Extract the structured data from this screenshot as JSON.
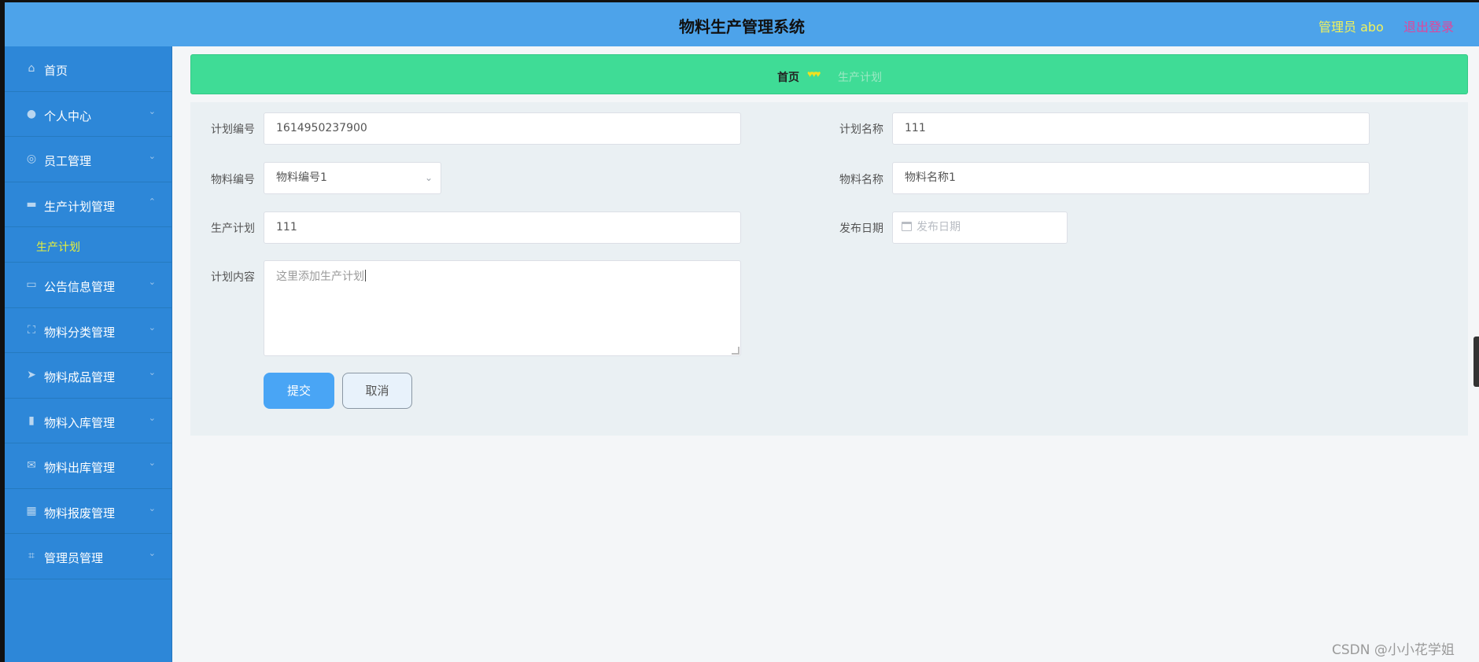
{
  "header": {
    "title": "物料生产管理系统",
    "user_label": "管理员 abo",
    "logout_label": "退出登录"
  },
  "sidebar": {
    "items": [
      {
        "label": "首页",
        "icon": "home-icon",
        "glyph": "⌂",
        "chevron": ""
      },
      {
        "label": "个人中心",
        "icon": "user-icon",
        "glyph": "●",
        "chevron": "⌄"
      },
      {
        "label": "员工管理",
        "icon": "support-icon",
        "glyph": "◎",
        "chevron": "⌄"
      },
      {
        "label": "生产计划管理",
        "icon": "monitor-icon",
        "glyph": "▬",
        "chevron": "⌃"
      },
      {
        "label": "公告信息管理",
        "icon": "notice-icon",
        "glyph": "▭",
        "chevron": "⌄"
      },
      {
        "label": "物料分类管理",
        "icon": "full-screen-icon",
        "glyph": "⛶",
        "chevron": "⌄"
      },
      {
        "label": "物料成品管理",
        "icon": "send-icon",
        "glyph": "➤",
        "chevron": "⌄"
      },
      {
        "label": "物料入库管理",
        "icon": "bar-chart-icon",
        "glyph": "▮",
        "chevron": "⌄"
      },
      {
        "label": "物料出库管理",
        "icon": "message-icon",
        "glyph": "✉",
        "chevron": "⌄"
      },
      {
        "label": "物料报废管理",
        "icon": "menu-grid-icon",
        "glyph": "▦",
        "chevron": "⌄"
      },
      {
        "label": "管理员管理",
        "icon": "crop-icon",
        "glyph": "⌗",
        "chevron": "⌄"
      }
    ],
    "submenu_active": "生产计划"
  },
  "breadcrumb": {
    "home": "首页",
    "separator": "♥♥♥",
    "current": "生产计划"
  },
  "form": {
    "plan_no_label": "计划编号",
    "plan_no_value": "1614950237900",
    "plan_name_label": "计划名称",
    "plan_name_value": "111",
    "material_no_label": "物料编号",
    "material_no_value": "物料编号1",
    "material_name_label": "物料名称",
    "material_name_value": "物料名称1",
    "production_plan_label": "生产计划",
    "production_plan_value": "111",
    "publish_date_label": "发布日期",
    "publish_date_placeholder": "发布日期",
    "content_label": "计划内容",
    "content_placeholder": "这里添加生产计划",
    "submit_label": "提交",
    "cancel_label": "取消"
  },
  "watermark": "CSDN @小小花学姐",
  "colors": {
    "header": "#4da3ea",
    "sidebar": "#2d87d8",
    "breadcrumb_bg": "#3fdc96",
    "submit": "#49a5f5",
    "user_text": "#f2f25a",
    "logout_text": "#e0459b",
    "active_submenu": "#e8f03a"
  }
}
